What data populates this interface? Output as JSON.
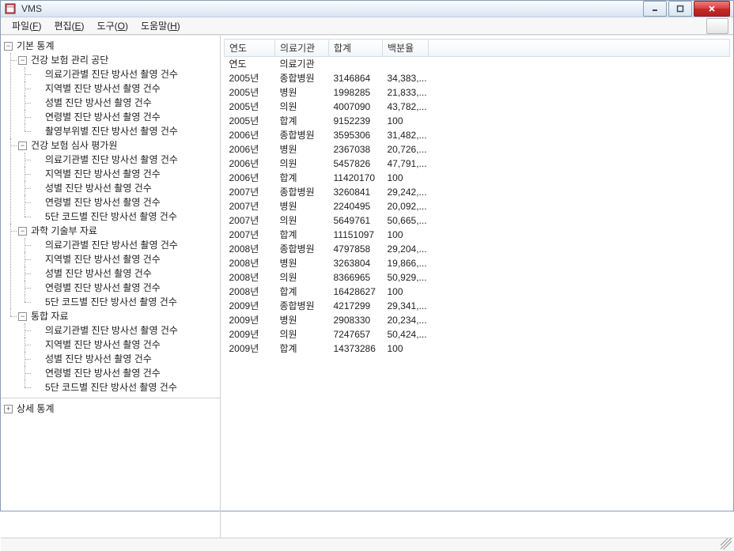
{
  "window": {
    "title": "VMS"
  },
  "menubar": {
    "file": {
      "label": "파일",
      "hotkey": "F"
    },
    "edit": {
      "label": "편집",
      "hotkey": "E"
    },
    "tools": {
      "label": "도구",
      "hotkey": "O"
    },
    "help": {
      "label": "도움말",
      "hotkey": "H"
    }
  },
  "tree": {
    "root": {
      "label": "기본 통계",
      "expanded": true
    },
    "groups": [
      {
        "label": "건강 보험 관리 공단",
        "expanded": true,
        "items": [
          "의료기관별 진단 방사선 촬영 건수",
          "지역별 진단 방사선 촬영 건수",
          "성별 진단 방사선 촬영 건수",
          "연령별 진단 방사선 촬영 건수",
          "촬영부위별 진단 방사선 촬영 건수"
        ]
      },
      {
        "label": "건강 보험 심사 평가원",
        "expanded": true,
        "items": [
          "의료기관별 진단 방사선 촬영 건수",
          "지역별 진단 방사선 촬영 건수",
          "성별 진단 방사선 촬영 건수",
          "연령별 진단 방사선 촬영 건수",
          "5단 코드별 진단 방사선 촬영 건수"
        ]
      },
      {
        "label": "과학 기술부 자료",
        "expanded": true,
        "items": [
          "의료기관별 진단 방사선 촬영 건수",
          "지역별 진단 방사선 촬영 건수",
          "성별 진단 방사선 촬영 건수",
          "연령별 진단 방사선 촬영 건수",
          "5단 코드별 진단 방사선 촬영 건수"
        ]
      },
      {
        "label": "통합 자료",
        "expanded": true,
        "items": [
          "의료기관별 진단 방사선 촬영 건수",
          "지역별 진단 방사선 촬영 건수",
          "성별 진단 방사선 촬영 건수",
          "연령별 진단 방사선 촬영 건수",
          "5단 코드별 진단 방사선 촬영 건수"
        ]
      }
    ],
    "detail": {
      "label": "상세 통계",
      "expanded": false
    }
  },
  "grid": {
    "columns": {
      "year": "연도",
      "institution": "의료기관",
      "total": "합계",
      "percent": "백분율"
    },
    "header_row": {
      "year": "연도",
      "institution": "의료기관",
      "total": "",
      "percent": ""
    },
    "rows": [
      {
        "year": "2005년",
        "institution": "종합병원",
        "total": "3146864",
        "percent": "34,383,..."
      },
      {
        "year": "2005년",
        "institution": "병원",
        "total": "1998285",
        "percent": "21,833,..."
      },
      {
        "year": "2005년",
        "institution": "의원",
        "total": "4007090",
        "percent": "43,782,..."
      },
      {
        "year": "2005년",
        "institution": "합계",
        "total": "9152239",
        "percent": "100"
      },
      {
        "year": "2006년",
        "institution": "종합병원",
        "total": "3595306",
        "percent": "31,482,..."
      },
      {
        "year": "2006년",
        "institution": "병원",
        "total": "2367038",
        "percent": "20,726,..."
      },
      {
        "year": "2006년",
        "institution": "의원",
        "total": "5457826",
        "percent": "47,791,..."
      },
      {
        "year": "2006년",
        "institution": "합계",
        "total": "11420170",
        "percent": "100"
      },
      {
        "year": "2007년",
        "institution": "종합병원",
        "total": "3260841",
        "percent": "29,242,..."
      },
      {
        "year": "2007년",
        "institution": "병원",
        "total": "2240495",
        "percent": "20,092,..."
      },
      {
        "year": "2007년",
        "institution": "의원",
        "total": "5649761",
        "percent": "50,665,..."
      },
      {
        "year": "2007년",
        "institution": "합계",
        "total": "11151097",
        "percent": "100"
      },
      {
        "year": "2008년",
        "institution": "종합병원",
        "total": "4797858",
        "percent": "29,204,..."
      },
      {
        "year": "2008년",
        "institution": "병원",
        "total": "3263804",
        "percent": "19,866,..."
      },
      {
        "year": "2008년",
        "institution": "의원",
        "total": "8366965",
        "percent": "50,929,..."
      },
      {
        "year": "2008년",
        "institution": "합계",
        "total": "16428627",
        "percent": "100"
      },
      {
        "year": "2009년",
        "institution": "종합병원",
        "total": "4217299",
        "percent": "29,341,..."
      },
      {
        "year": "2009년",
        "institution": "병원",
        "total": "2908330",
        "percent": "20,234,..."
      },
      {
        "year": "2009년",
        "institution": "의원",
        "total": "7247657",
        "percent": "50,424,..."
      },
      {
        "year": "2009년",
        "institution": "합계",
        "total": "14373286",
        "percent": "100"
      }
    ]
  }
}
